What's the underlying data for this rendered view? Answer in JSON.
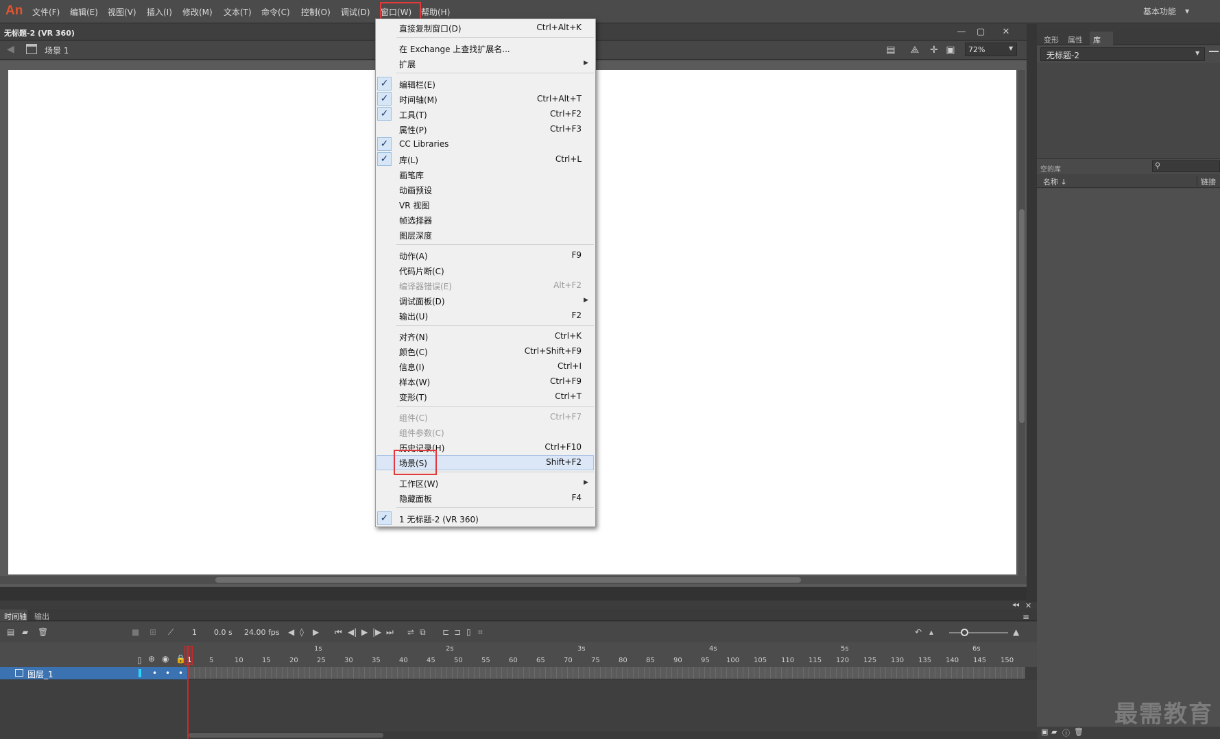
{
  "app": {
    "logo": "An"
  },
  "menubar": {
    "items": [
      "文件(F)",
      "编辑(E)",
      "视图(V)",
      "插入(I)",
      "修改(M)",
      "文本(T)",
      "命令(C)",
      "控制(O)",
      "调试(D)",
      "窗口(W)",
      "帮助(H)"
    ],
    "workspace": "基本功能"
  },
  "document": {
    "title": "无标题-2 (VR 360)",
    "scene": "场景 1",
    "zoom": "72%",
    "window_buttons": [
      "—",
      "▢",
      "✕"
    ]
  },
  "window_menu": [
    {
      "label": "直接复制窗口(D)",
      "shortcut": "Ctrl+Alt+K",
      "checked": false,
      "disabled": false,
      "submenu": false
    },
    {
      "sep": true
    },
    {
      "label": "在 Exchange 上查找扩展名...",
      "shortcut": "",
      "checked": false,
      "disabled": false,
      "submenu": false
    },
    {
      "label": "扩展",
      "shortcut": "",
      "checked": false,
      "disabled": false,
      "submenu": true
    },
    {
      "sep": true
    },
    {
      "label": "编辑栏(E)",
      "shortcut": "",
      "checked": true,
      "disabled": false,
      "submenu": false
    },
    {
      "label": "时间轴(M)",
      "shortcut": "Ctrl+Alt+T",
      "checked": true,
      "disabled": false,
      "submenu": false
    },
    {
      "label": "工具(T)",
      "shortcut": "Ctrl+F2",
      "checked": true,
      "disabled": false,
      "submenu": false
    },
    {
      "label": "属性(P)",
      "shortcut": "Ctrl+F3",
      "checked": false,
      "disabled": false,
      "submenu": false
    },
    {
      "label": "CC Libraries",
      "shortcut": "",
      "checked": true,
      "disabled": false,
      "submenu": false
    },
    {
      "label": "库(L)",
      "shortcut": "Ctrl+L",
      "checked": true,
      "disabled": false,
      "submenu": false
    },
    {
      "label": "画笔库",
      "shortcut": "",
      "checked": false,
      "disabled": false,
      "submenu": false
    },
    {
      "label": "动画预设",
      "shortcut": "",
      "checked": false,
      "disabled": false,
      "submenu": false
    },
    {
      "label": "VR 视图",
      "shortcut": "",
      "checked": false,
      "disabled": false,
      "submenu": false
    },
    {
      "label": "帧选择器",
      "shortcut": "",
      "checked": false,
      "disabled": false,
      "submenu": false
    },
    {
      "label": "图层深度",
      "shortcut": "",
      "checked": false,
      "disabled": false,
      "submenu": false
    },
    {
      "sep": true
    },
    {
      "label": "动作(A)",
      "shortcut": "F9",
      "checked": false,
      "disabled": false,
      "submenu": false
    },
    {
      "label": "代码片断(C)",
      "shortcut": "",
      "checked": false,
      "disabled": false,
      "submenu": false
    },
    {
      "label": "编译器错误(E)",
      "shortcut": "Alt+F2",
      "checked": false,
      "disabled": true,
      "submenu": false
    },
    {
      "label": "调试面板(D)",
      "shortcut": "",
      "checked": false,
      "disabled": false,
      "submenu": true
    },
    {
      "label": "输出(U)",
      "shortcut": "F2",
      "checked": false,
      "disabled": false,
      "submenu": false
    },
    {
      "sep": true
    },
    {
      "label": "对齐(N)",
      "shortcut": "Ctrl+K",
      "checked": false,
      "disabled": false,
      "submenu": false
    },
    {
      "label": "颜色(C)",
      "shortcut": "Ctrl+Shift+F9",
      "checked": false,
      "disabled": false,
      "submenu": false
    },
    {
      "label": "信息(I)",
      "shortcut": "Ctrl+I",
      "checked": false,
      "disabled": false,
      "submenu": false
    },
    {
      "label": "样本(W)",
      "shortcut": "Ctrl+F9",
      "checked": false,
      "disabled": false,
      "submenu": false
    },
    {
      "label": "变形(T)",
      "shortcut": "Ctrl+T",
      "checked": false,
      "disabled": false,
      "submenu": false
    },
    {
      "sep": true
    },
    {
      "label": "组件(C)",
      "shortcut": "Ctrl+F7",
      "checked": false,
      "disabled": true,
      "submenu": false
    },
    {
      "label": "组件参数(C)",
      "shortcut": "",
      "checked": false,
      "disabled": true,
      "submenu": false
    },
    {
      "label": "历史记录(H)",
      "shortcut": "Ctrl+F10",
      "checked": false,
      "disabled": false,
      "submenu": false
    },
    {
      "label": "场景(S)",
      "shortcut": "Shift+F2",
      "checked": false,
      "disabled": false,
      "submenu": false,
      "highlighted": true
    },
    {
      "sep": true
    },
    {
      "label": "工作区(W)",
      "shortcut": "",
      "checked": false,
      "disabled": false,
      "submenu": true
    },
    {
      "label": "隐藏面板",
      "shortcut": "F4",
      "checked": false,
      "disabled": false,
      "submenu": false
    },
    {
      "sep": true
    },
    {
      "label": "1 无标题-2 (VR 360)",
      "shortcut": "",
      "checked": true,
      "disabled": false,
      "submenu": false
    }
  ],
  "right_panel": {
    "tabs": [
      "变形",
      "属性",
      "库"
    ],
    "active_tab": "库",
    "library_select": "无标题-2",
    "library_count": "空的库",
    "col_name": "名称 ↓",
    "col_link": "链接"
  },
  "timeline": {
    "tabs": [
      "时间轴",
      "输出"
    ],
    "current_frame": "1",
    "time": "0.0 s",
    "fps": "24.00 fps",
    "seconds": [
      "1s",
      "2s",
      "3s",
      "4s",
      "5s",
      "6s"
    ],
    "frames": [
      "1",
      "5",
      "10",
      "15",
      "20",
      "25",
      "30",
      "35",
      "40",
      "45",
      "50",
      "55",
      "60",
      "65",
      "70",
      "75",
      "80",
      "85",
      "90",
      "95",
      "100",
      "105",
      "110",
      "115",
      "120",
      "125",
      "130",
      "135",
      "140",
      "145",
      "150"
    ],
    "layer_name": "图层_1"
  },
  "watermark": "最需教育",
  "colors": {
    "accent_red": "#e23a3a",
    "logo": "#e2542e",
    "layer_selected": "#3b72b2",
    "playhead": "#d02828"
  }
}
